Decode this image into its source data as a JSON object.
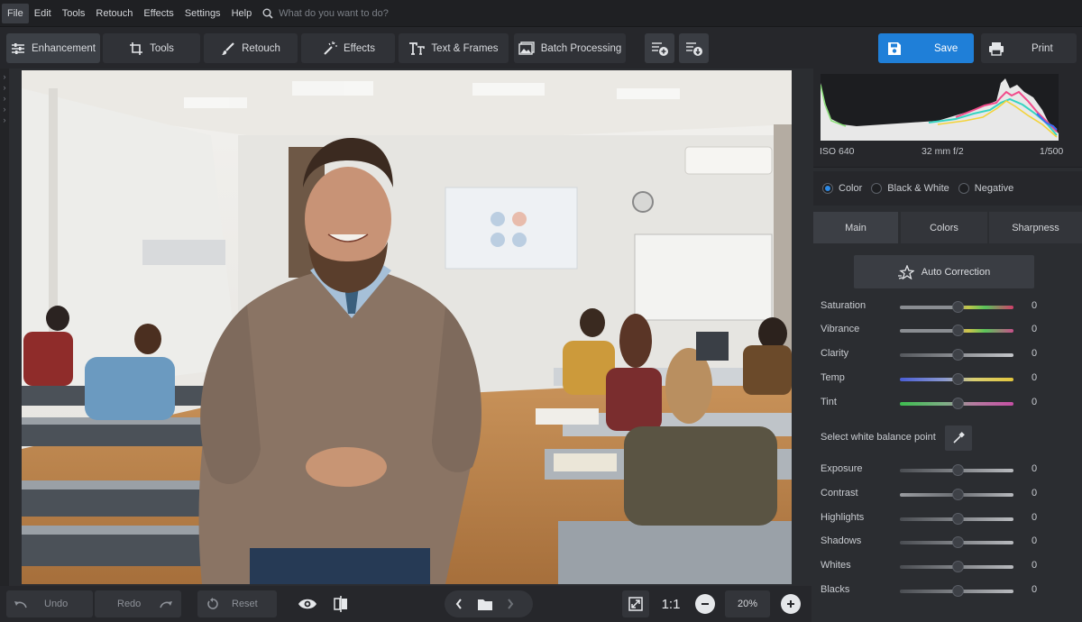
{
  "menu": {
    "items": [
      "File",
      "Edit",
      "Tools",
      "Retouch",
      "Effects",
      "Settings",
      "Help"
    ],
    "search_placeholder": "What do you want to do?"
  },
  "toolbar": {
    "tabs": [
      "Enhancement",
      "Tools",
      "Retouch",
      "Effects",
      "Text & Frames",
      "Batch Processing"
    ],
    "active_tab": "Enhancement",
    "save_label": "Save",
    "print_label": "Print"
  },
  "histogram": {
    "iso": "ISO 640",
    "lens": "32 mm f/2",
    "shutter": "1/500"
  },
  "color_mode": {
    "options": [
      "Color",
      "Black & White",
      "Negative"
    ],
    "selected": "Color"
  },
  "panel_tabs": [
    "Main",
    "Colors",
    "Sharpness"
  ],
  "active_panel_tab": "Main",
  "auto_correction_label": "Auto Correction",
  "color_adjustments": [
    {
      "label": "Saturation",
      "value": "0"
    },
    {
      "label": "Vibrance",
      "value": "0"
    },
    {
      "label": "Clarity",
      "value": "0"
    },
    {
      "label": "Temp",
      "value": "0"
    },
    {
      "label": "Tint",
      "value": "0"
    }
  ],
  "white_balance_label": "Select white balance point",
  "tone_adjustments": [
    {
      "label": "Exposure",
      "value": "0"
    },
    {
      "label": "Contrast",
      "value": "0"
    },
    {
      "label": "Highlights",
      "value": "0"
    },
    {
      "label": "Shadows",
      "value": "0"
    },
    {
      "label": "Whites",
      "value": "0"
    },
    {
      "label": "Blacks",
      "value": "0"
    }
  ],
  "bottom": {
    "undo_label": "Undo",
    "redo_label": "Redo",
    "reset_label": "Reset",
    "fit_label": "1:1",
    "zoom": "20%"
  },
  "colors": {
    "accent": "#1f7fd8",
    "background": "#2b2d31"
  }
}
